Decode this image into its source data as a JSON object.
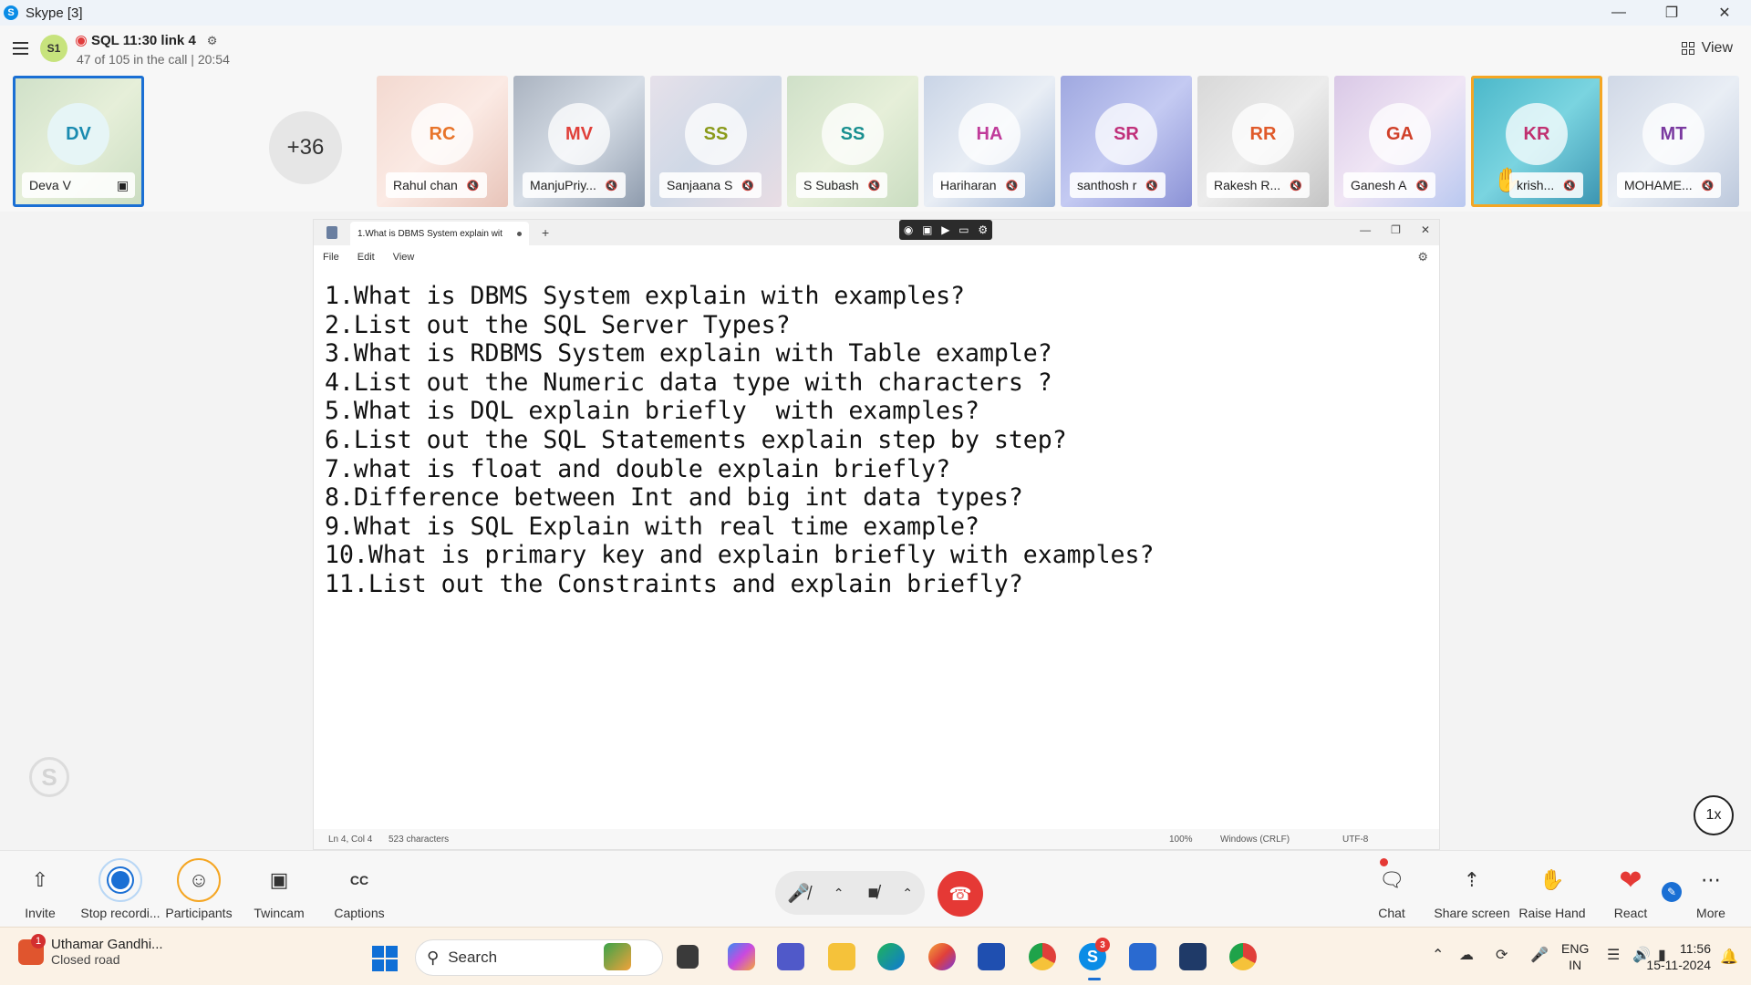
{
  "window": {
    "title": "Skype [3]",
    "app_icon": "S"
  },
  "call": {
    "avatar": "S1",
    "title": "SQL 11:30 link 4",
    "subtitle": "47 of 105 in the call | 20:54",
    "view_label": "View"
  },
  "participants": {
    "self": {
      "initials": "DV",
      "name": "Deva V"
    },
    "more_count": "+36",
    "tiles": [
      {
        "initials": "RC",
        "name": "Rahul chan",
        "color": "#e8742a"
      },
      {
        "initials": "MV",
        "name": "ManjuPriy...",
        "color": "#e0403a"
      },
      {
        "initials": "SS",
        "name": "Sanjaana S",
        "color": "#8a9a1a"
      },
      {
        "initials": "SS",
        "name": "S Subash",
        "color": "#188f8f"
      },
      {
        "initials": "HA",
        "name": "Hariharan",
        "color": "#c03b9a"
      },
      {
        "initials": "SR",
        "name": "santhosh r",
        "color": "#c0307a"
      },
      {
        "initials": "RR",
        "name": "Rakesh R...",
        "color": "#e05a2a"
      },
      {
        "initials": "GA",
        "name": "Ganesh A",
        "color": "#d0402a"
      },
      {
        "initials": "KR",
        "name": "krish...",
        "color": "#c03070"
      },
      {
        "initials": "MT",
        "name": "MOHAME...",
        "color": "#7a3aa0"
      }
    ]
  },
  "notepad": {
    "tab_title": "1.What is DBMS System explain wit",
    "menu": [
      "File",
      "Edit",
      "View"
    ],
    "lines": [
      "1.What is DBMS System explain with examples?",
      "2.List out the SQL Server Types?",
      "3.What is RDBMS System explain with Table example?",
      "4.List out the Numeric data type with characters ?",
      "5.What is DQL explain briefly  with examples?",
      "6.List out the SQL Statements explain step by step?",
      "7.what is float and double explain briefly?",
      "8.Difference between Int and big int data types?",
      "9.What is SQL Explain with real time example?",
      "10.What is primary key and explain briefly with examples?",
      "11.List out the Constraints and explain briefly?"
    ],
    "status": {
      "position": "Ln 4, Col 4",
      "chars": "523 characters",
      "zoom": "100%",
      "line_ending": "Windows (CRLF)",
      "encoding": "UTF-8"
    }
  },
  "speed_label": "1x",
  "controls": {
    "invite": "Invite",
    "stop_recording": "Stop recordi...",
    "participants": "Participants",
    "twincam": "Twincam",
    "captions": "Captions",
    "chat": "Chat",
    "share_screen": "Share screen",
    "raise_hand": "Raise Hand",
    "react": "React",
    "more": "More"
  },
  "taskbar": {
    "weather_title": "Uthamar Gandhi...",
    "weather_sub": "Closed road",
    "weather_badge": "1",
    "search_label": "Search",
    "skype_badge": "3",
    "lang1": "ENG",
    "lang2": "IN",
    "time": "11:56",
    "date": "15-11-2024"
  }
}
